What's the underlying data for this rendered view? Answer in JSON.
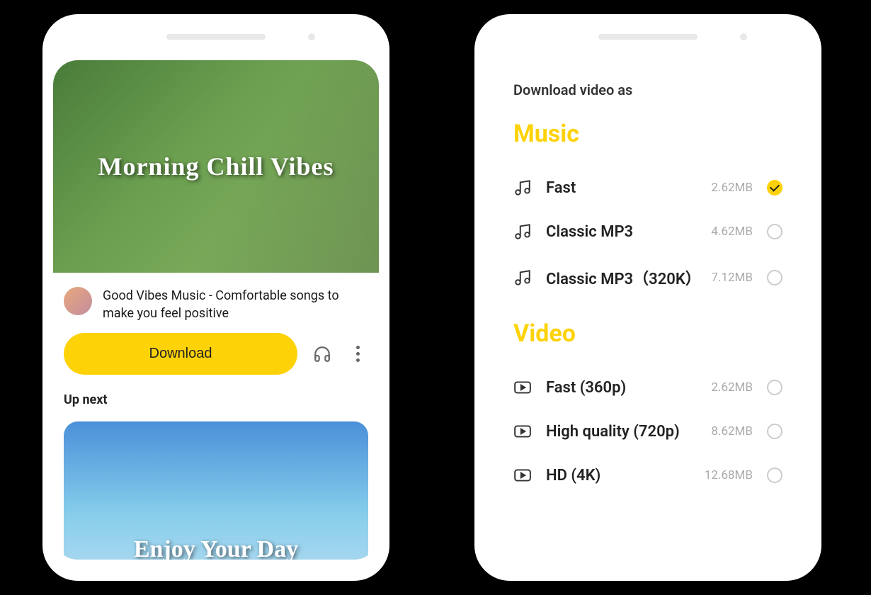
{
  "phone1": {
    "video": {
      "overlay_title": "Morning Chill Vibes",
      "description": "Good Vibes Music - Comfortable songs to make you feel positive"
    },
    "download_button": "Download",
    "up_next_label": "Up next",
    "next_video": {
      "overlay_title": "Enjoy Your Day"
    }
  },
  "phone2": {
    "panel_title": "Download video as",
    "sections": {
      "music": {
        "heading": "Music",
        "options": [
          {
            "label": "Fast",
            "size": "2.62MB",
            "selected": true
          },
          {
            "label": "Classic MP3",
            "size": "4.62MB",
            "selected": false
          },
          {
            "label": "Classic MP3（320K）",
            "size": "7.12MB",
            "selected": false
          }
        ]
      },
      "video": {
        "heading": "Video",
        "options": [
          {
            "label": "Fast (360p)",
            "size": "2.62MB",
            "selected": false
          },
          {
            "label": "High quality (720p)",
            "size": "8.62MB",
            "selected": false
          },
          {
            "label": "HD (4K)",
            "size": "12.68MB",
            "selected": false
          }
        ]
      }
    }
  }
}
